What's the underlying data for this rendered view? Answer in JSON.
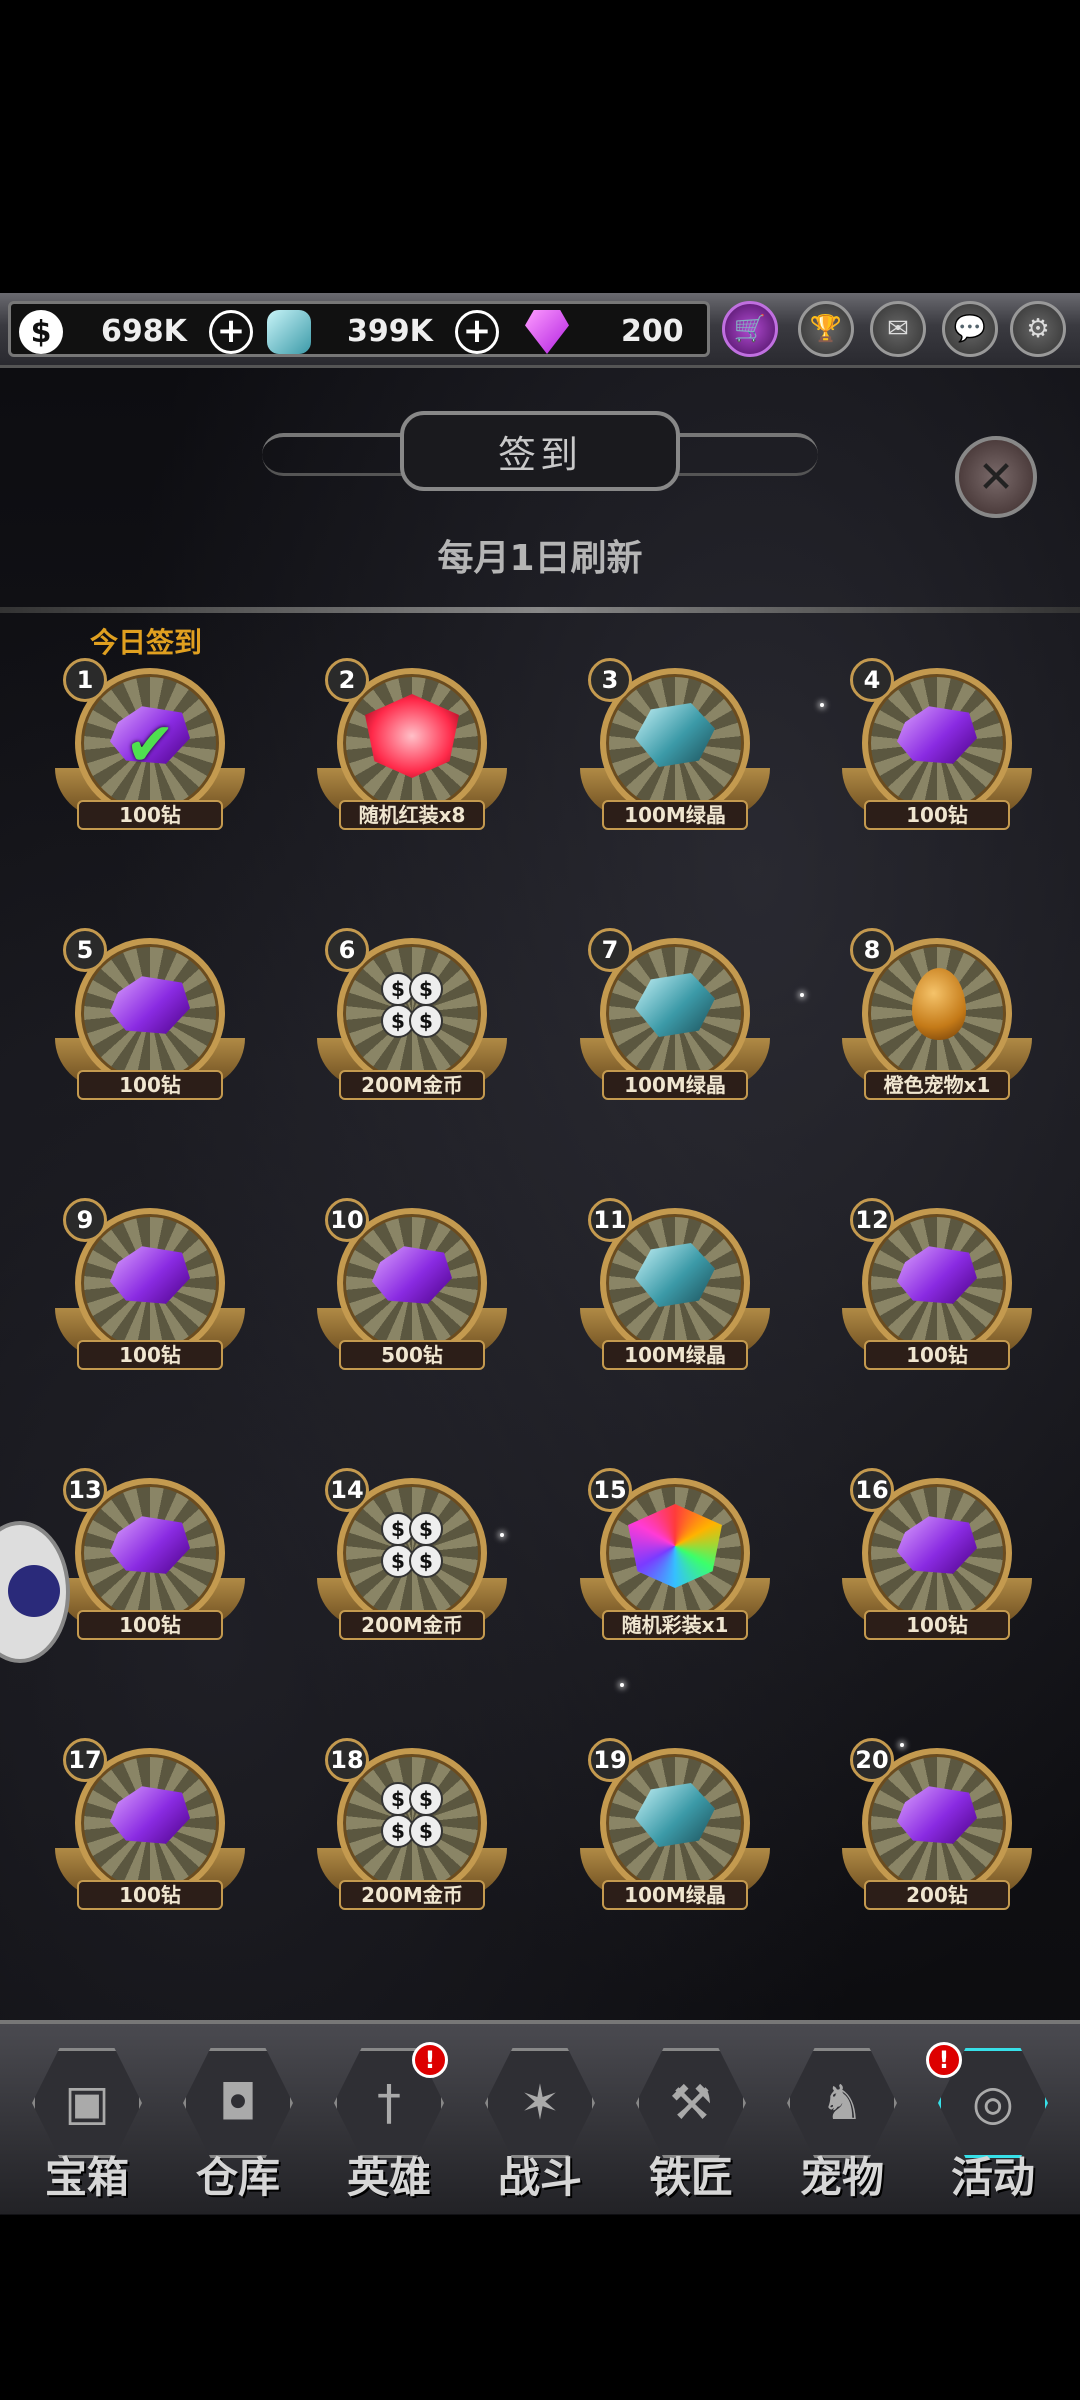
{
  "currency": {
    "gold": {
      "icon": "dollar-icon",
      "value": "698K"
    },
    "crystal": {
      "icon": "crystal-icon",
      "value": "399K"
    },
    "diamond": {
      "icon": "diamond-icon",
      "value": "200"
    }
  },
  "top_buttons": [
    "shop-cart-icon",
    "trophy-icon",
    "mail-icon",
    "chat-icon",
    "gear-icon"
  ],
  "header": {
    "title": "签到",
    "subtitle": "每月1日刷新",
    "today_label": "今日签到"
  },
  "rewards": [
    {
      "day": "1",
      "label": "100钻",
      "type": "diamond",
      "claimed": true
    },
    {
      "day": "2",
      "label": "随机红装x8",
      "type": "redgear",
      "claimed": false
    },
    {
      "day": "3",
      "label": "100M绿晶",
      "type": "crystal",
      "claimed": false
    },
    {
      "day": "4",
      "label": "100钻",
      "type": "diamond",
      "claimed": false
    },
    {
      "day": "5",
      "label": "100钻",
      "type": "diamond",
      "claimed": false
    },
    {
      "day": "6",
      "label": "200M金币",
      "type": "coins",
      "claimed": false
    },
    {
      "day": "7",
      "label": "100M绿晶",
      "type": "crystal",
      "claimed": false
    },
    {
      "day": "8",
      "label": "橙色宠物x1",
      "type": "egg",
      "claimed": false
    },
    {
      "day": "9",
      "label": "100钻",
      "type": "diamond",
      "claimed": false
    },
    {
      "day": "10",
      "label": "500钻",
      "type": "diamond",
      "claimed": false
    },
    {
      "day": "11",
      "label": "100M绿晶",
      "type": "crystal",
      "claimed": false
    },
    {
      "day": "12",
      "label": "100钻",
      "type": "diamond",
      "claimed": false
    },
    {
      "day": "13",
      "label": "100钻",
      "type": "diamond",
      "claimed": false
    },
    {
      "day": "14",
      "label": "200M金币",
      "type": "coins",
      "claimed": false
    },
    {
      "day": "15",
      "label": "随机彩装x1",
      "type": "rainbow",
      "claimed": false
    },
    {
      "day": "16",
      "label": "100钻",
      "type": "diamond",
      "claimed": false
    },
    {
      "day": "17",
      "label": "100钻",
      "type": "diamond",
      "claimed": false
    },
    {
      "day": "18",
      "label": "200M金币",
      "type": "coins",
      "claimed": false
    },
    {
      "day": "19",
      "label": "100M绿晶",
      "type": "crystal",
      "claimed": false
    },
    {
      "day": "20",
      "label": "200钻",
      "type": "diamond",
      "claimed": false
    }
  ],
  "nav": [
    {
      "label": "宝箱",
      "icon": "chest-icon",
      "badge": false,
      "active": false
    },
    {
      "label": "仓库",
      "icon": "backpack-icon",
      "badge": false,
      "active": false
    },
    {
      "label": "英雄",
      "icon": "sword-icon",
      "badge": true,
      "active": false
    },
    {
      "label": "战斗",
      "icon": "battle-icon",
      "badge": false,
      "active": false
    },
    {
      "label": "铁匠",
      "icon": "anvil-icon",
      "badge": false,
      "active": false
    },
    {
      "label": "宠物",
      "icon": "dragon-icon",
      "badge": false,
      "active": false
    },
    {
      "label": "活动",
      "icon": "portal-icon",
      "badge": true,
      "active": true
    }
  ],
  "badge_mark": "!",
  "colors": {
    "gold_frame": "#c49a4f",
    "today_label": "#e0a020",
    "active_nav": "#37e0e8",
    "badge": "#dd0000"
  }
}
